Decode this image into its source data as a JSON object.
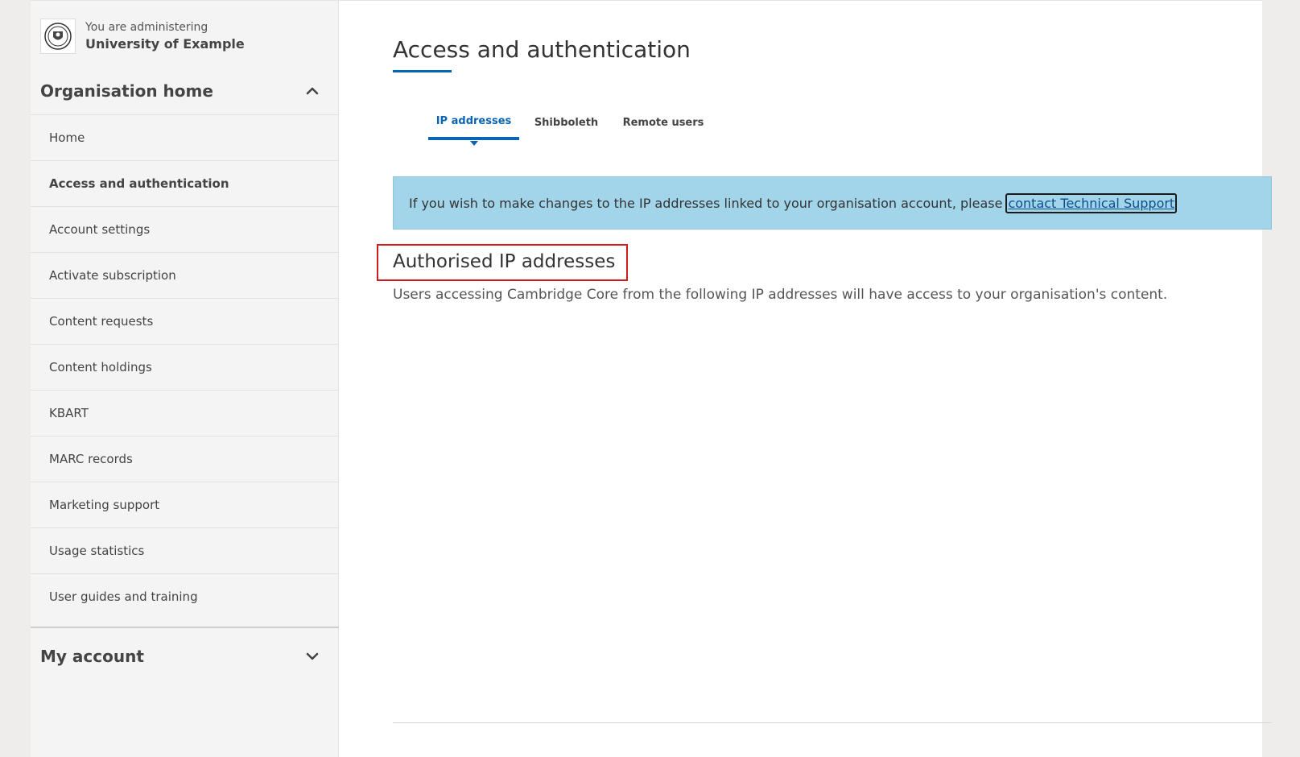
{
  "org": {
    "pre_label": "You are administering",
    "name": "University of Example"
  },
  "sidebar": {
    "org_home_title": "Organisation home",
    "items": [
      {
        "label": "Home"
      },
      {
        "label": "Access and authentication"
      },
      {
        "label": "Account settings"
      },
      {
        "label": "Activate subscription"
      },
      {
        "label": "Content requests"
      },
      {
        "label": "Content holdings"
      },
      {
        "label": "KBART"
      },
      {
        "label": "MARC records"
      },
      {
        "label": "Marketing support"
      },
      {
        "label": "Usage statistics"
      },
      {
        "label": "User guides and training"
      }
    ],
    "my_account_title": "My account"
  },
  "main": {
    "title": "Access and authentication",
    "tabs": [
      {
        "label": "IP addresses"
      },
      {
        "label": "Shibboleth"
      },
      {
        "label": "Remote users"
      }
    ],
    "banner_text": "If you wish to make changes to the IP addresses linked to your organisation account, please",
    "banner_link": "contact Technical Support",
    "section_heading": "Authorised IP addresses",
    "section_desc": "Users accessing Cambridge Core from the following IP addresses will have access to your organisation's content."
  },
  "colors": {
    "accent": "#0a64b4",
    "banner_bg": "#a3d5ea",
    "highlight": "#cc1c1c"
  },
  "icons": {
    "crest": "university-crest-icon",
    "collapse": "chevron-up-icon",
    "expand": "chevron-down-icon"
  }
}
